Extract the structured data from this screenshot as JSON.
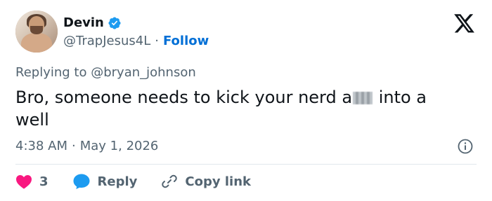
{
  "author": {
    "name": "Devin",
    "handle": "@TrapJesus4L",
    "separator": "·",
    "follow_label": "Follow"
  },
  "reply_context": {
    "prefix": "Replying to",
    "mention": "@bryan_johnson"
  },
  "tweet": {
    "text_before": "Bro, someone needs to kick your nerd a",
    "text_after": " into a well"
  },
  "meta": {
    "time": "4:38 AM",
    "separator": "·",
    "date": "May 1, 2026"
  },
  "actions": {
    "like_count": "3",
    "reply_label": "Reply",
    "copy_link_label": "Copy link"
  },
  "colors": {
    "accent": "#1d9bf0",
    "follow": "#006fd6",
    "like": "#f91880",
    "muted": "#536471",
    "text": "#0f1419"
  },
  "icons": [
    "verified-badge-icon",
    "x-logo-icon",
    "info-icon",
    "heart-icon",
    "reply-bubble-icon",
    "link-icon"
  ]
}
